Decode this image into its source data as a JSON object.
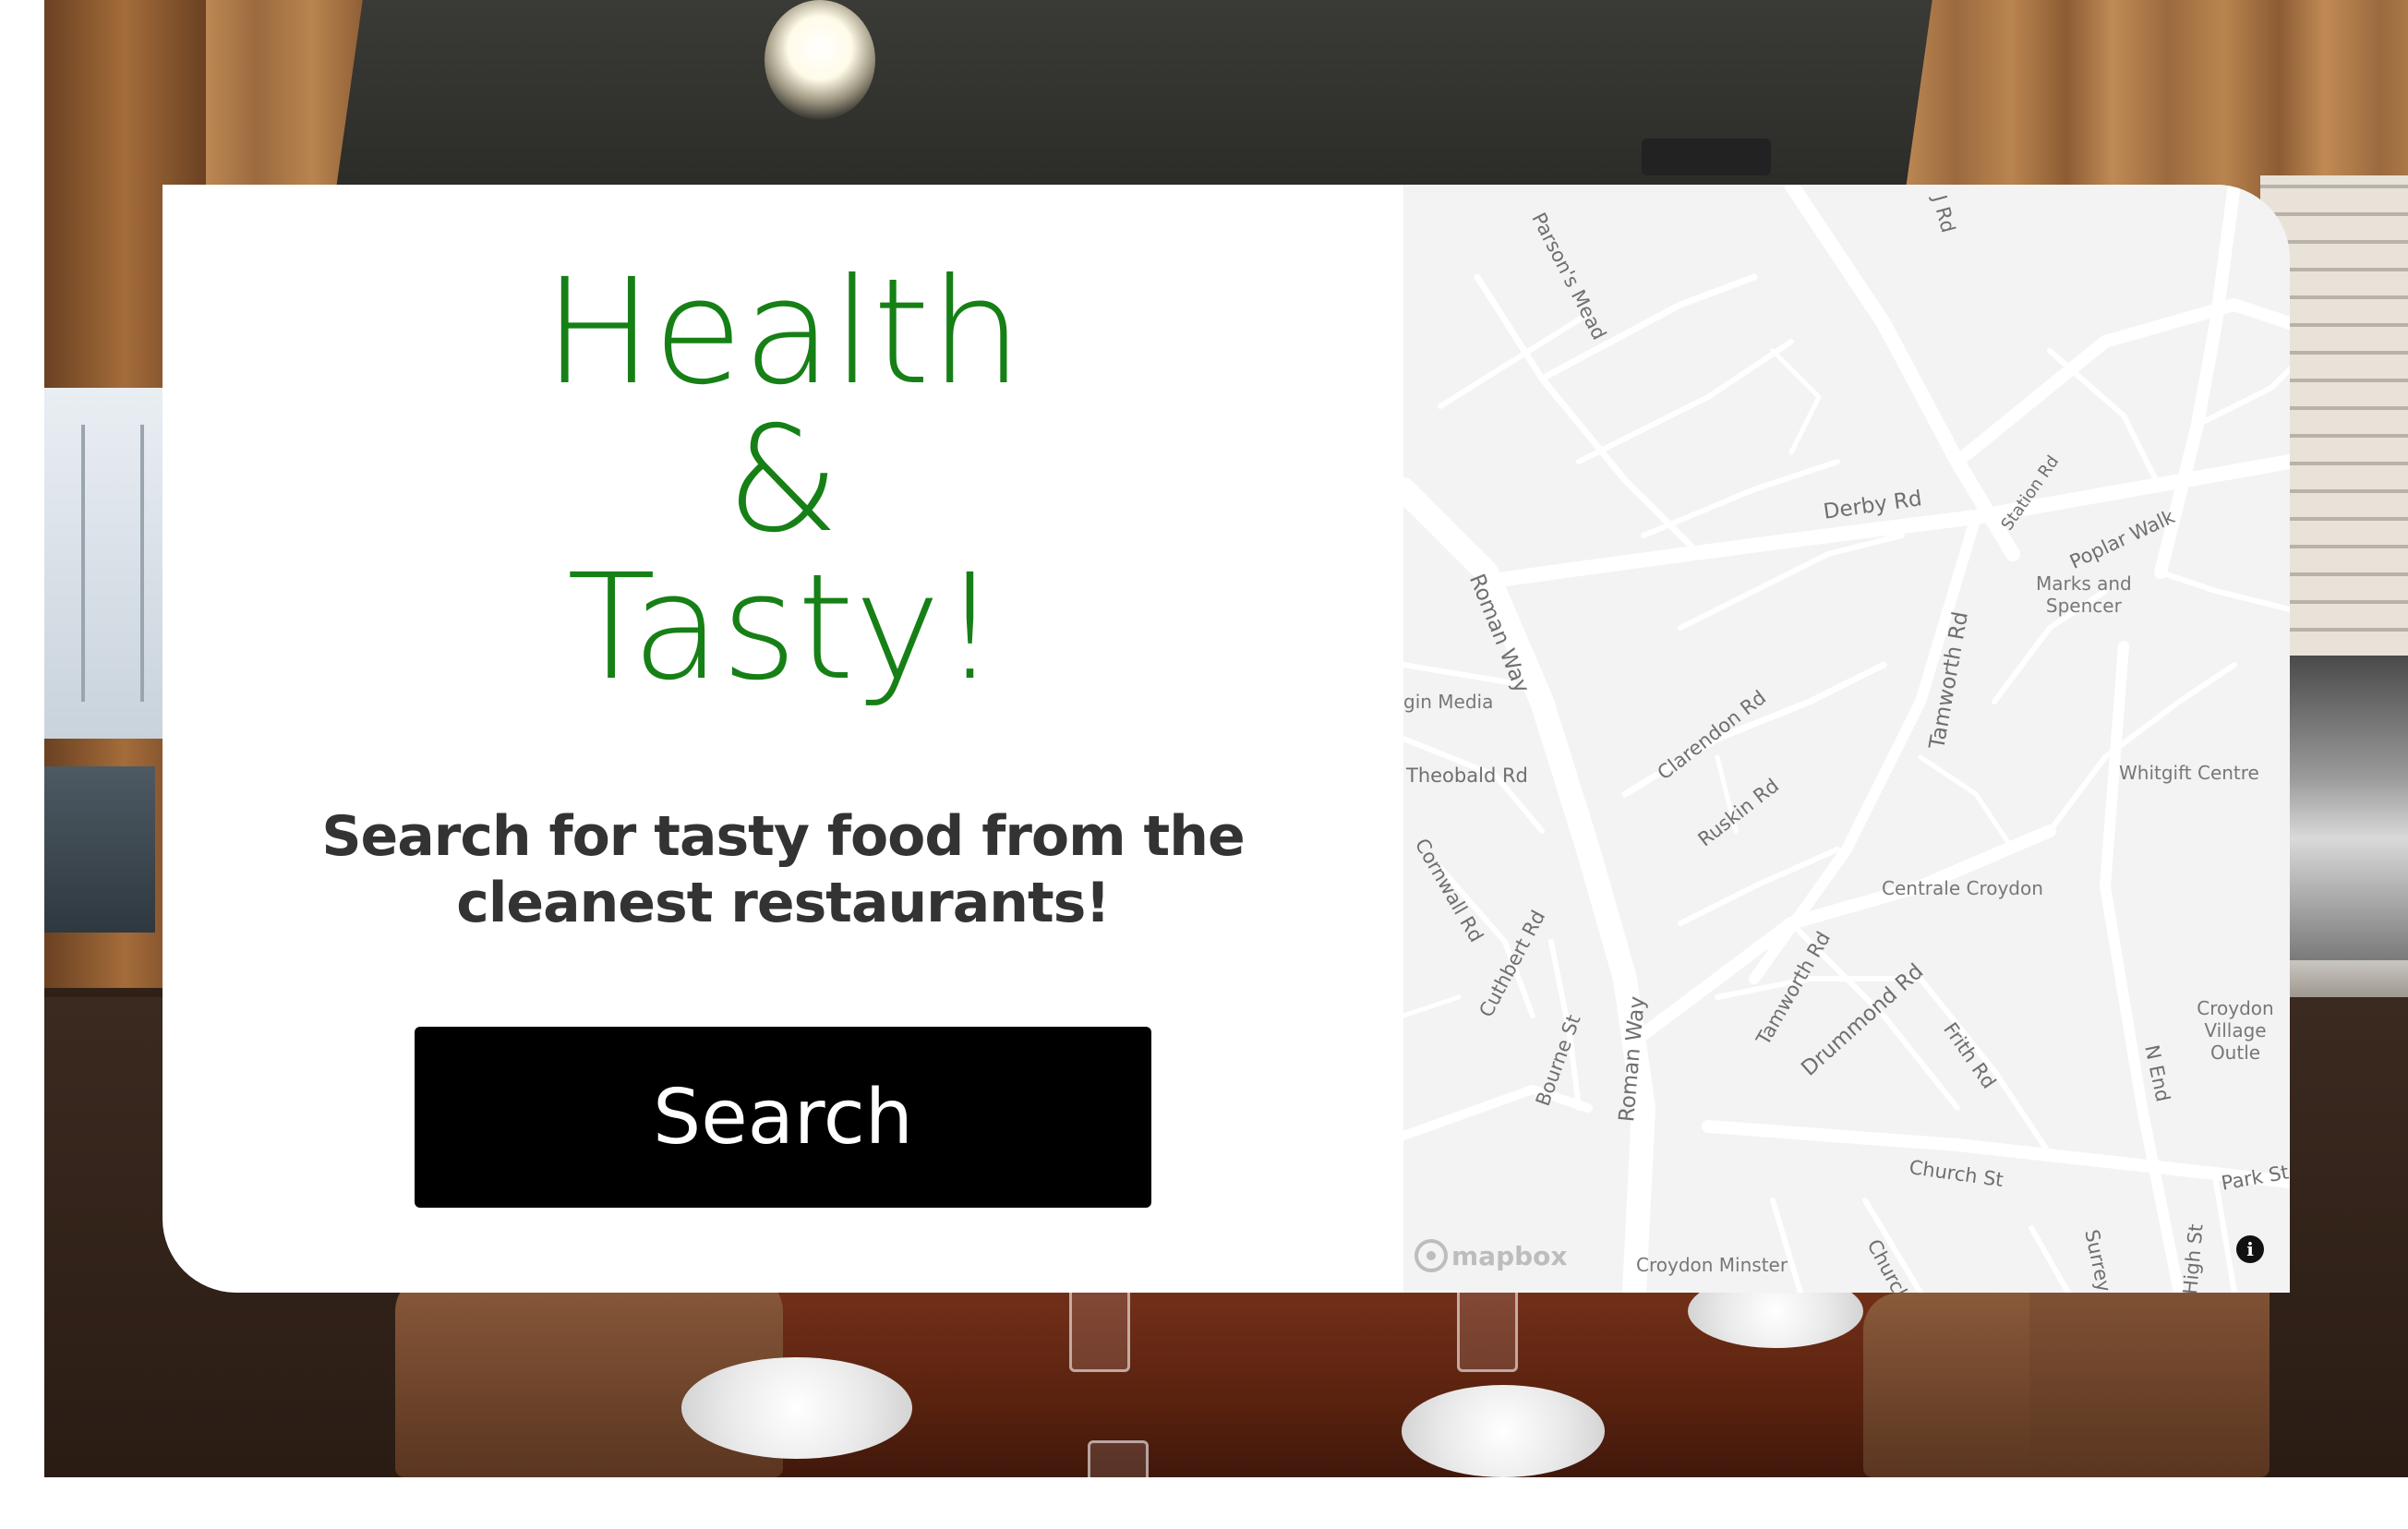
{
  "hero": {
    "headline_line1": "Health",
    "headline_line2": "&",
    "headline_line3": "Tasty!",
    "subtitle": "Search for tasty food from the cleanest restaurants!",
    "search_button_label": "Search",
    "headline_color": "#168016",
    "button_color": "#000000"
  },
  "map": {
    "attribution_logo": "mapbox",
    "info_icon": "info-icon",
    "street_labels": [
      "Parson's Mead",
      "J Rd",
      "Derby Rd",
      "Station Rd",
      "Poplar Walk",
      "Roman Way",
      "Tamworth Rd",
      "Clarendon Rd",
      "Ruskin Rd",
      "Theobald Rd",
      "Cornwall Rd",
      "Cuthbert Rd",
      "Bourne St",
      "Roman Way",
      "Tamworth Rd",
      "Drummond Rd",
      "Frith Rd",
      "Church St",
      "Church",
      "N End",
      "Park St",
      "Surrey S",
      "High St"
    ],
    "poi_labels": [
      "Marks and\nSpencer",
      "gin Media",
      "Whitgift Centre",
      "Centrale Croydon",
      "Croydon\nVillage Outle",
      "Croydon Minster"
    ]
  }
}
